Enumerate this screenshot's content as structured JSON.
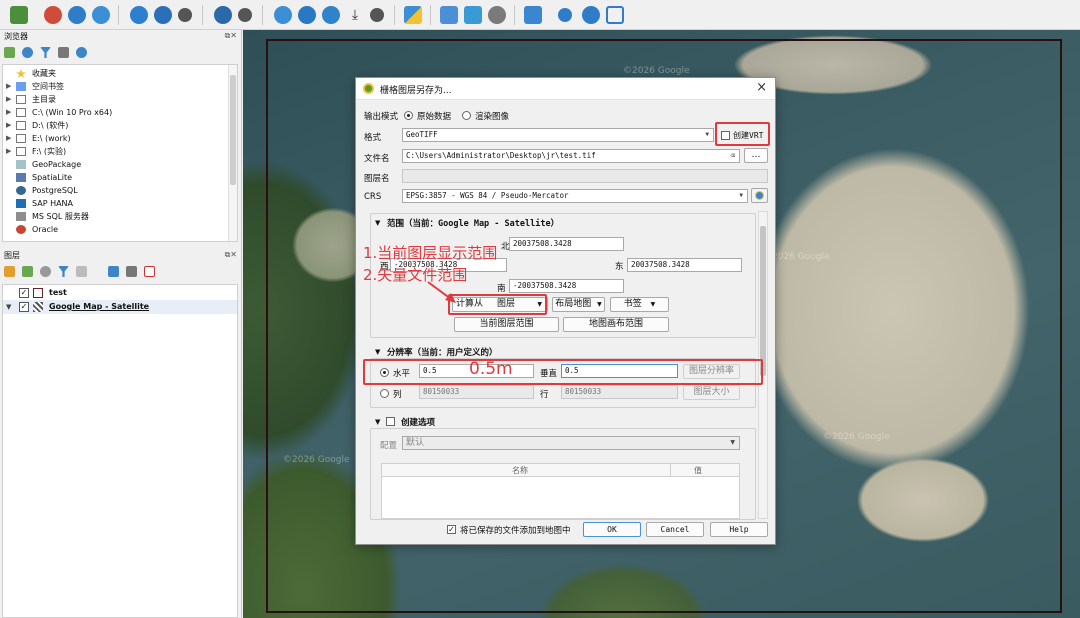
{
  "toolbar": {
    "icons": [
      "data-source-manager-icon",
      "new-project-icon",
      "identify-icon",
      "globe-icon",
      "settings-icon",
      "globe-pan-icon",
      "plugin-globe-icon",
      "gear-icon",
      "visibility-icon",
      "gear-icon",
      "map-tips-icon",
      "globe-refresh-icon",
      "download-icon",
      "settings-icon",
      "zoom-full-icon",
      "save-layout-icon",
      "layout-manager-icon",
      "python-icon",
      "layer-styling-icon",
      "gear-icon",
      "zoom-icon",
      "full-extent-icon"
    ]
  },
  "browser_panel": {
    "title": "浏览器",
    "items": [
      {
        "label": "收藏夹",
        "icon": "star-icon"
      },
      {
        "label": "空间书签",
        "icon": "bookmark-icon"
      },
      {
        "label": "主目录",
        "icon": "home-icon"
      },
      {
        "label": "C:\\ (Win 10 Pro x64)",
        "icon": "folder-icon"
      },
      {
        "label": "D:\\ (软件)",
        "icon": "folder-icon"
      },
      {
        "label": "E:\\ (work)",
        "icon": "folder-icon"
      },
      {
        "label": "F:\\ (实验)",
        "icon": "folder-icon"
      },
      {
        "label": "GeoPackage",
        "icon": "geopackage-icon"
      },
      {
        "label": "SpatiaLite",
        "icon": "spatialite-icon"
      },
      {
        "label": "PostgreSQL",
        "icon": "postgresql-icon"
      },
      {
        "label": "SAP HANA",
        "icon": "saphana-icon"
      },
      {
        "label": "MS SQL 服务器",
        "icon": "mssql-icon"
      },
      {
        "label": "Oracle",
        "icon": "oracle-icon"
      }
    ]
  },
  "layers_panel": {
    "title": "图层",
    "layers": [
      {
        "label": "test",
        "checked": true
      },
      {
        "label": "Google Map - Satellite",
        "checked": true
      }
    ]
  },
  "map": {
    "watermarks": [
      "©2026 Google",
      "©2026 Google",
      "©2026 Google",
      "©2026 Google"
    ]
  },
  "dialog": {
    "title": "栅格图层另存为...",
    "close": "×",
    "output_mode_label": "输出模式",
    "raw_data_label": "原始数据",
    "render_image_label": "渲染图像",
    "format_label": "格式",
    "format_value": "GeoTIFF",
    "create_vrt_label": "创建VRT",
    "file_name_label": "文件名",
    "file_name_value": "C:\\Users\\Administrator\\Desktop\\jr\\test.tif",
    "browse_button": "…",
    "layer_name_label": "图层名",
    "crs_label": "CRS",
    "crs_value": "EPSG:3857 - WGS 84 / Pseudo-Mercator",
    "extent_title": "范围（当前：Google Map - Satellite）",
    "north_label": "北",
    "north_value": "20037508.3428",
    "west_label": "西",
    "west_value": "-20037508.3428",
    "east_label": "东",
    "east_value": "20037508.3428",
    "south_label": "南",
    "south_value": "-20037508.3428",
    "calculate_from_label": "计算从",
    "layer_combo": "图层",
    "layout_map_combo": "布局地图",
    "bookmark_combo": "书签",
    "current_layer_extent_button": "当前图层范围",
    "map_canvas_extent_button": "地图画布范围",
    "resolution_title": "分辨率（当前：用户定义的）",
    "horizontal_label": "水平",
    "horizontal_value": "0.5",
    "vertical_label": "垂直",
    "vertical_value": "0.5",
    "layer_resolution_button": "图层分辨率",
    "columns_label": "列",
    "columns_value": "80150033",
    "rows_label": "行",
    "rows_value": "80150033",
    "layer_size_button": "图层大小",
    "create_options_title": "创建选项",
    "profile_label": "配置",
    "profile_value": "默认",
    "table_name_header": "名称",
    "table_value_header": "值",
    "add_to_map_label": "将已保存的文件添加到地图中",
    "ok_button": "OK",
    "cancel_button": "Cancel",
    "help_button": "Help"
  },
  "annotations": {
    "line1": "1.当前图层显示范围",
    "line2": "2.矢量文件范围",
    "resolution_note": "0.5m",
    "color": "#e0393e"
  }
}
